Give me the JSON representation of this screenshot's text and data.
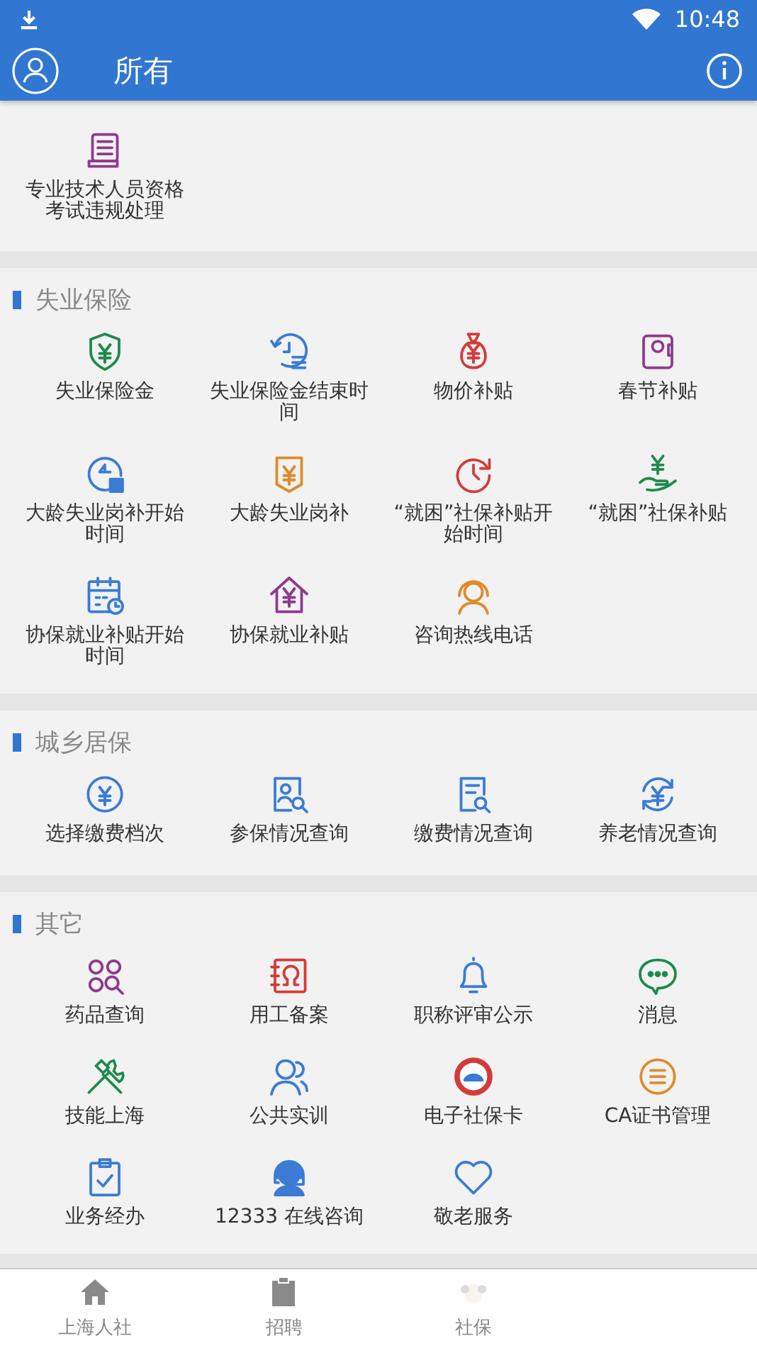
{
  "status_bar": {
    "time": "10:48"
  },
  "header": {
    "title": "所有"
  },
  "sections": [
    {
      "items": [
        {
          "label": "专业技术人员资格考试违规处理"
        }
      ]
    },
    {
      "title": "失业保险",
      "items": [
        {
          "label": "失业保险金"
        },
        {
          "label": "失业保险金结束时间"
        },
        {
          "label": "物价补贴"
        },
        {
          "label": "春节补贴"
        },
        {
          "label": "大龄失业岗补开始时间"
        },
        {
          "label": "大龄失业岗补"
        },
        {
          "label": "“就困”社保补贴开始时间"
        },
        {
          "label": "“就困”社保补贴"
        },
        {
          "label": "协保就业补贴开始时间"
        },
        {
          "label": "协保就业补贴"
        },
        {
          "label": "咨询热线电话"
        }
      ]
    },
    {
      "title": "城乡居保",
      "items": [
        {
          "label": "选择缴费档次"
        },
        {
          "label": "参保情况查询"
        },
        {
          "label": "缴费情况查询"
        },
        {
          "label": "养老情况查询"
        }
      ]
    },
    {
      "title": "其它",
      "items": [
        {
          "label": "药品查询"
        },
        {
          "label": "用工备案"
        },
        {
          "label": "职称评审公示"
        },
        {
          "label": "消息"
        },
        {
          "label": "技能上海"
        },
        {
          "label": "公共实训"
        },
        {
          "label": "电子社保卡"
        },
        {
          "label": "CA证书管理"
        },
        {
          "label": "业务经办"
        },
        {
          "label": "12333 在线咨询"
        },
        {
          "label": "敬老服务"
        }
      ]
    }
  ],
  "tab_bar": [
    {
      "label": "上海人社"
    },
    {
      "label": "招聘"
    },
    {
      "label": "社保"
    }
  ]
}
